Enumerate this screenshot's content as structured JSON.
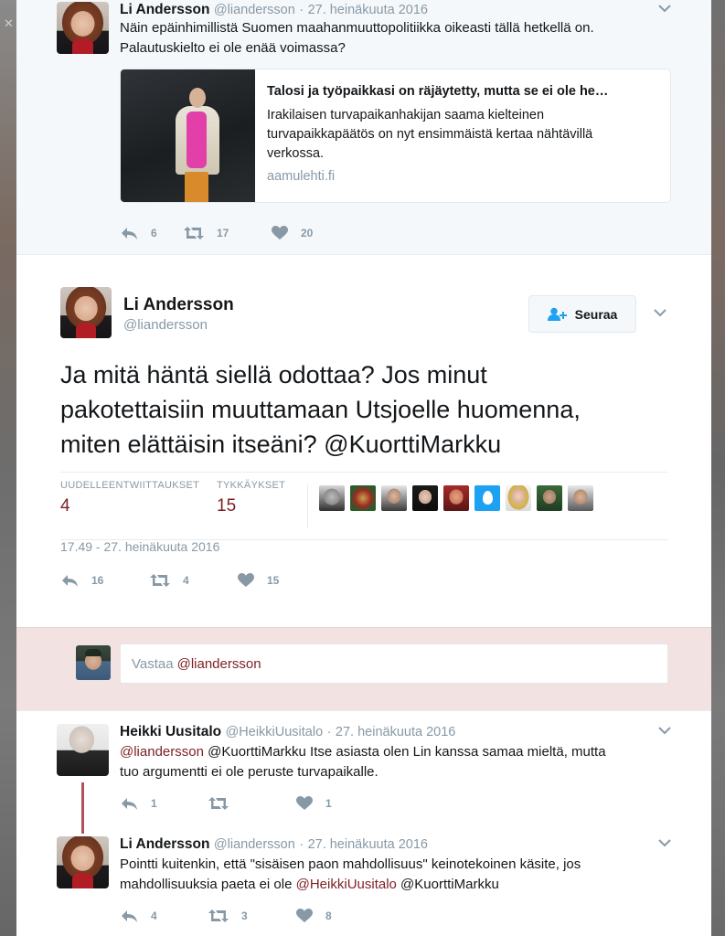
{
  "parent_tweet": {
    "name": "Li Andersson",
    "handle": "@liandersson",
    "dot": "·",
    "date": "27. heinäkuuta 2016",
    "text_line1": "Näin epäinhimillistä Suomen maahanmuuttopolitiikka oikeasti tällä hetkellä on.",
    "text_line2": "Palautuskielto ei ole enää voimassa?",
    "card": {
      "title": "Talosi ja työpaikkasi on räjäytetty, mutta se ei ole he…",
      "desc_line1": "Irakilaisen turvapaikanhakijan saama kielteinen",
      "desc_line2": "turvapaikkapäätös on nyt ensimmäistä kertaa nähtävillä",
      "desc_line3": "verkossa.",
      "domain": "aamulehti.fi"
    },
    "replies": "6",
    "retweets": "17",
    "likes": "20"
  },
  "main_tweet": {
    "name": "Li Andersson",
    "handle": "@liandersson",
    "follow_label": "Seuraa",
    "text_line1": "Ja mitä häntä siellä odottaa? Jos minut",
    "text_line2": "pakotettaisiin muuttamaan Utsjoelle huomenna,",
    "text_line3_pre": "miten elättäisin itseäni? ",
    "text_line3_mention": "@KuorttiMarkku",
    "retweets_label": "UUDELLEENTWIITTAUKSET",
    "retweets_value": "4",
    "likes_label": "TYKKÄYKSET",
    "likes_value": "15",
    "timestamp": "17.49 - 27. heinäkuuta 2016",
    "replies": "16",
    "retweet_count": "4",
    "like_count": "15"
  },
  "reply_box": {
    "placeholder_prefix": "Vastaa ",
    "placeholder_mention": "@liandersson"
  },
  "reply1": {
    "name": "Heikki Uusitalo",
    "handle": "@HeikkiUusitalo",
    "dot": "·",
    "date": "27. heinäkuuta 2016",
    "mention": "@liandersson",
    "text_line1_rest": " @KuorttiMarkku Itse asiasta olen Lin kanssa samaa mieltä, mutta",
    "text_line2": "tuo argumentti ei ole peruste turvapaikalle.",
    "replies": "1",
    "retweets": "",
    "likes": "1"
  },
  "reply2": {
    "name": "Li Andersson",
    "handle": "@liandersson",
    "dot": "·",
    "date": "27. heinäkuuta 2016",
    "text_line1": "Pointti kuitenkin, että \"sisäisen paon mahdollisuus\" keinotekoinen käsite, jos",
    "text_line2_pre": "mahdollisuuksia paeta ei ole ",
    "text_line2_mention": "@HeikkiUusitalo",
    "text_line2_post": " @KuorttiMarkku",
    "replies": "4",
    "retweets": "3",
    "likes": "8"
  },
  "colors": {
    "accent": "#7d1f24",
    "muted": "#8899a6",
    "reply_bg": "#f2e2e2",
    "thread_line": "#b0525a"
  },
  "icons": [
    "reply-icon",
    "retweet-icon",
    "heart-icon",
    "chevron-down-icon",
    "follow-user-icon",
    "close-icon"
  ]
}
